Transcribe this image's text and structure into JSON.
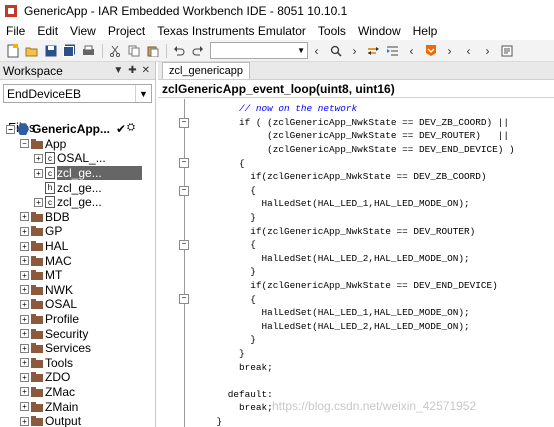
{
  "window": {
    "title": "GenericApp - IAR Embedded Workbench IDE - 8051 10.10.1"
  },
  "menu": [
    "File",
    "Edit",
    "View",
    "Project",
    "Texas Instruments Emulator",
    "Tools",
    "Window",
    "Help"
  ],
  "workspace": {
    "title": "Workspace",
    "config": "EndDeviceEB",
    "files_label": "Files",
    "tree": [
      {
        "label": "GenericApp...",
        "type": "project",
        "level": 0,
        "exp": "−",
        "check": "✔"
      },
      {
        "label": "App",
        "type": "folder",
        "level": 1,
        "exp": "−"
      },
      {
        "label": "OSAL_...",
        "type": "file",
        "level": 2,
        "exp": "+"
      },
      {
        "label": "zcl_ge...",
        "type": "file",
        "level": 2,
        "exp": "+",
        "selected": true
      },
      {
        "label": "zcl_ge...",
        "type": "header",
        "level": 2,
        "exp": ""
      },
      {
        "label": "zcl_ge...",
        "type": "file",
        "level": 2,
        "exp": "+"
      },
      {
        "label": "BDB",
        "type": "folder",
        "level": 1,
        "exp": "+"
      },
      {
        "label": "GP",
        "type": "folder",
        "level": 1,
        "exp": "+"
      },
      {
        "label": "HAL",
        "type": "folder",
        "level": 1,
        "exp": "+"
      },
      {
        "label": "MAC",
        "type": "folder",
        "level": 1,
        "exp": "+"
      },
      {
        "label": "MT",
        "type": "folder",
        "level": 1,
        "exp": "+"
      },
      {
        "label": "NWK",
        "type": "folder",
        "level": 1,
        "exp": "+"
      },
      {
        "label": "OSAL",
        "type": "folder",
        "level": 1,
        "exp": "+"
      },
      {
        "label": "Profile",
        "type": "folder",
        "level": 1,
        "exp": "+"
      },
      {
        "label": "Security",
        "type": "folder",
        "level": 1,
        "exp": "+"
      },
      {
        "label": "Services",
        "type": "folder",
        "level": 1,
        "exp": "+"
      },
      {
        "label": "Tools",
        "type": "folder",
        "level": 1,
        "exp": "+"
      },
      {
        "label": "ZDO",
        "type": "folder",
        "level": 1,
        "exp": "+"
      },
      {
        "label": "ZMac",
        "type": "folder",
        "level": 1,
        "exp": "+"
      },
      {
        "label": "ZMain",
        "type": "folder",
        "level": 1,
        "exp": "+"
      },
      {
        "label": "Output",
        "type": "folder",
        "level": 1,
        "exp": "+"
      }
    ]
  },
  "editor": {
    "tab": "zcl_genericapp",
    "function": "zclGenericApp_event_loop(uint8, uint16)",
    "lines": [
      {
        "text": "        // now on the network",
        "cls": "comment",
        "fold": false
      },
      {
        "text": "        if ( (zclGenericApp_NwkState == DEV_ZB_COORD) ||",
        "fold": true
      },
      {
        "text": "             (zclGenericApp_NwkState == DEV_ROUTER)   ||",
        "fold": false
      },
      {
        "text": "             (zclGenericApp_NwkState == DEV_END_DEVICE) )",
        "fold": false
      },
      {
        "text": "        {",
        "fold": true
      },
      {
        "text": "          if(zclGenericApp_NwkState == DEV_ZB_COORD)",
        "fold": false
      },
      {
        "text": "          {",
        "fold": true
      },
      {
        "text": "            HalLedSet(HAL_LED_1,HAL_LED_MODE_ON);",
        "fold": false
      },
      {
        "text": "          }",
        "fold": false
      },
      {
        "text": "          if(zclGenericApp_NwkState == DEV_ROUTER)",
        "fold": false
      },
      {
        "text": "          {",
        "fold": true
      },
      {
        "text": "            HalLedSet(HAL_LED_2,HAL_LED_MODE_ON);",
        "fold": false
      },
      {
        "text": "          }",
        "fold": false
      },
      {
        "text": "          if(zclGenericApp_NwkState == DEV_END_DEVICE)",
        "fold": false
      },
      {
        "text": "          {",
        "fold": true
      },
      {
        "text": "            HalLedSet(HAL_LED_1,HAL_LED_MODE_ON);",
        "fold": false
      },
      {
        "text": "            HalLedSet(HAL_LED_2,HAL_LED_MODE_ON);",
        "fold": false
      },
      {
        "text": "          }",
        "fold": false
      },
      {
        "text": "        }",
        "fold": false
      },
      {
        "text": "        break;",
        "fold": false
      },
      {
        "text": "",
        "fold": false
      },
      {
        "text": "      default:",
        "fold": false
      },
      {
        "text": "        break;",
        "fold": false
      },
      {
        "text": "    }",
        "fold": false
      }
    ]
  },
  "watermark": "https://blog.csdn.net/weixin_42571952"
}
